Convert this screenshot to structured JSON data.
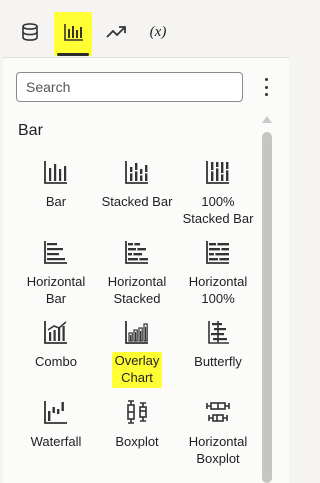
{
  "tabs": [
    {
      "name": "data",
      "icon": "database-icon"
    },
    {
      "name": "visualizations",
      "icon": "bar-chart-icon",
      "active": true
    },
    {
      "name": "analytics",
      "icon": "trend-icon"
    },
    {
      "name": "calculations",
      "label": "(x)"
    }
  ],
  "search": {
    "placeholder": "Search"
  },
  "section": {
    "title": "Bar"
  },
  "charts": [
    {
      "label": "Bar",
      "icon": "bar-chart-icon"
    },
    {
      "label": "Stacked Bar",
      "icon": "stacked-bar-icon"
    },
    {
      "label": "100%\nStacked Bar",
      "icon": "stacked-100-bar-icon"
    },
    {
      "label": "Horizontal\nBar",
      "icon": "horizontal-bar-icon"
    },
    {
      "label": "Horizontal\nStacked",
      "icon": "horizontal-stacked-icon"
    },
    {
      "label": "Horizontal\n100%",
      "icon": "horizontal-100-icon"
    },
    {
      "label": "Combo",
      "icon": "combo-chart-icon"
    },
    {
      "label": "Overlay\nChart",
      "icon": "overlay-chart-icon",
      "highlighted": true
    },
    {
      "label": "Butterfly",
      "icon": "butterfly-chart-icon"
    },
    {
      "label": "Waterfall",
      "icon": "waterfall-chart-icon"
    },
    {
      "label": "Boxplot",
      "icon": "boxplot-icon"
    },
    {
      "label": "Horizontal\nBoxplot",
      "icon": "horizontal-boxplot-icon"
    }
  ],
  "colors": {
    "highlight": "#ffff33",
    "icon": "#333333",
    "background": "#f5f4f2"
  }
}
